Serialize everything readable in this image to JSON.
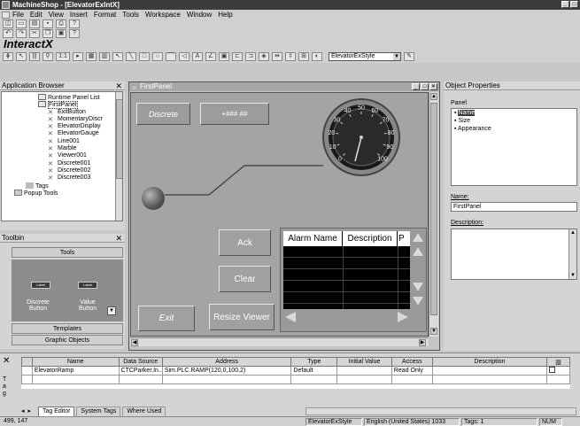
{
  "window": {
    "title": "MachineShop - [ElevatorExIntX]"
  },
  "menu": [
    "File",
    "Edit",
    "View",
    "Insert",
    "Format",
    "Tools",
    "Workspace",
    "Window",
    "Help"
  ],
  "toolbar": {
    "ratio_label": "1:1",
    "style_select_value": "ElevatorExStyle"
  },
  "brand": "InteractX",
  "app_browser": {
    "title": "Application Browser",
    "items": [
      "Runtime Panel List",
      "FirstPanel",
      "ExitButton",
      "MomentaryDiscr",
      "ElevatorDisplay",
      "ElevatorGauge",
      "Line001",
      "Marble",
      "Viewer001",
      "Discrete001",
      "Discrete002",
      "Discrete003",
      "Tags",
      "Popup Tools"
    ]
  },
  "toolbox": {
    "title": "Toolbin",
    "category": "Tools",
    "widget_face_label": "Label",
    "widgets": [
      "Discrete Button",
      "Value Button"
    ],
    "sections": [
      "Templates",
      "Graphic Objects"
    ]
  },
  "panel_window": {
    "title": "FirstPanel",
    "discrete_label": "Discrete",
    "value_display": "+### ##",
    "ack_label": "Ack",
    "clear_label": "Clear",
    "exit_label": "Exit",
    "resize_label": "Resize Viewer",
    "alarm_headers": [
      "Alarm Name",
      "Description",
      "P"
    ],
    "gauge_ticks": [
      "0",
      "10",
      "20",
      "30",
      "40",
      "50",
      "60",
      "70",
      "80",
      "90",
      "100"
    ]
  },
  "properties": {
    "title": "Object Properties",
    "section": "Panel",
    "items": [
      "Name",
      "Size",
      "Appearance"
    ],
    "name_label": "Name:",
    "name_value": "FirstPanel",
    "description_label": "Description:"
  },
  "tag_editor": {
    "headers": [
      "Name",
      "Data Source",
      "Address",
      "Type",
      "Initial Value",
      "Access",
      "Description"
    ],
    "row": {
      "name": "ElevatorRamp",
      "source": "CTCParker.In..",
      "address": "Sim.PLC.RAMP(120,0,100,2)",
      "type": "Default",
      "initial": "",
      "access": "Read Only",
      "description": ""
    },
    "tabs": [
      "Tag Editor",
      "System Tags",
      "Where Used"
    ]
  },
  "status": {
    "coords": "499, 147",
    "style": "ElevatorExStyle",
    "language": "English (United States) 1033",
    "tags": "Tags: 1",
    "num": "NUM"
  }
}
